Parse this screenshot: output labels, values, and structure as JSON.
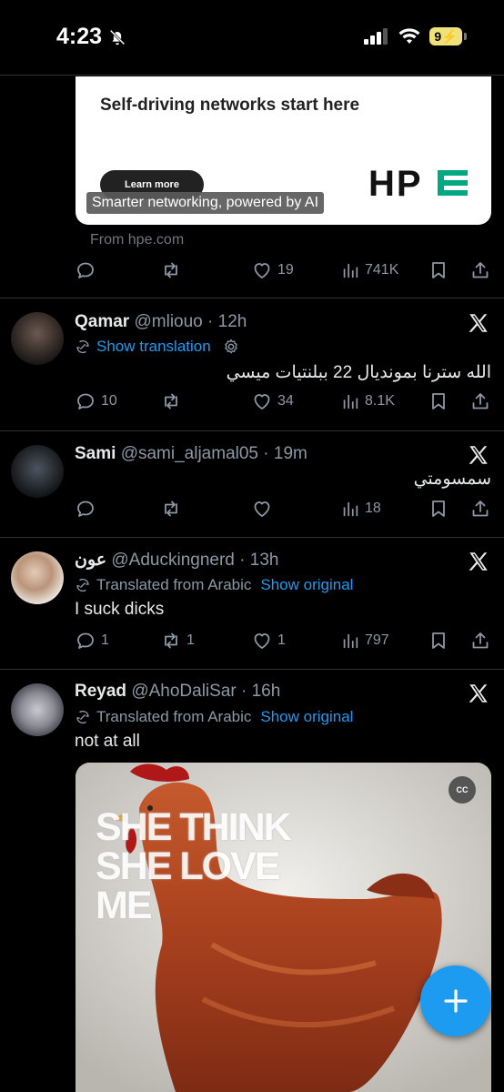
{
  "status_bar": {
    "time": "4:23",
    "battery": "9"
  },
  "ad": {
    "headline": "Self-driving networks start here",
    "cta": "Learn more",
    "logo": "HPE",
    "caption": "Smarter networking, powered by AI",
    "from": "From hpe.com",
    "stats": {
      "replies": "",
      "reposts": "",
      "likes": "19",
      "views": "741K"
    }
  },
  "tweets": [
    {
      "name": "Qamar",
      "handle": "@mliouo",
      "time": "12h",
      "translate_link": "Show translation",
      "text": "الله سترنا بمونديال 22 ببلنتيات ميسي",
      "stats": {
        "replies": "10",
        "reposts": "",
        "likes": "34",
        "views": "8.1K"
      }
    },
    {
      "name": "Sami",
      "handle": "@sami_aljamal05",
      "time": "19m",
      "text": "سمسومتي",
      "stats": {
        "replies": "",
        "reposts": "",
        "likes": "",
        "views": "18"
      }
    },
    {
      "name": "عون",
      "handle": "@Aduckingnerd",
      "time": "13h",
      "translated_label": "Translated from Arabic",
      "show_original": "Show original",
      "text": "I suck dicks",
      "stats": {
        "replies": "1",
        "reposts": "1",
        "likes": "1",
        "views": "797"
      }
    },
    {
      "name": "Reyad",
      "handle": "@AhoDaliSar",
      "time": "16h",
      "translated_label": "Translated from Arabic",
      "show_original": "Show original",
      "text": "not at all",
      "media": {
        "overlay_text": [
          "SHE THINK",
          "SHE LOVE",
          "ME"
        ],
        "badge": "CC"
      }
    }
  ],
  "colors": {
    "accent": "#1d9bf0",
    "muted": "#8b98a5",
    "background": "#000000"
  }
}
